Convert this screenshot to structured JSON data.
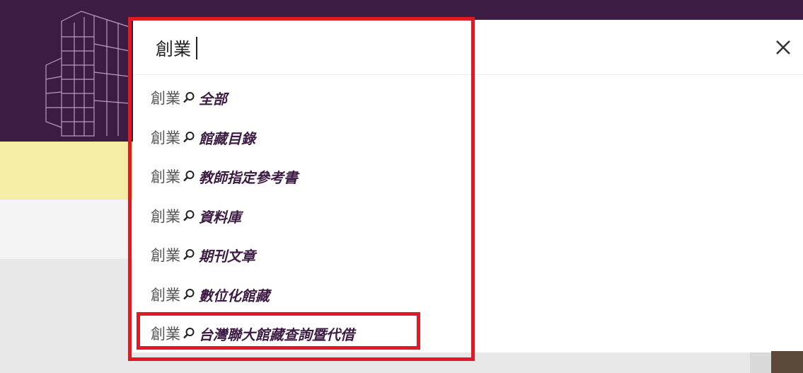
{
  "search": {
    "query": "創業",
    "close_label": "×"
  },
  "suggestions": [
    {
      "term": "創業",
      "scope": "全部"
    },
    {
      "term": "創業",
      "scope": "館藏目錄"
    },
    {
      "term": "創業",
      "scope": "教師指定參考書"
    },
    {
      "term": "創業",
      "scope": "資料庫"
    },
    {
      "term": "創業",
      "scope": "期刊文章"
    },
    {
      "term": "創業",
      "scope": "數位化館藏"
    },
    {
      "term": "創業",
      "scope": "台灣聯大館藏查詢暨代借"
    }
  ],
  "colors": {
    "header": "#3d1c44",
    "banner": "#f5eda4",
    "highlight": "#e01a22",
    "scope_text": "#3d1c44"
  },
  "icons": {
    "suggestion": "magnifier-icon",
    "close": "close-icon"
  }
}
